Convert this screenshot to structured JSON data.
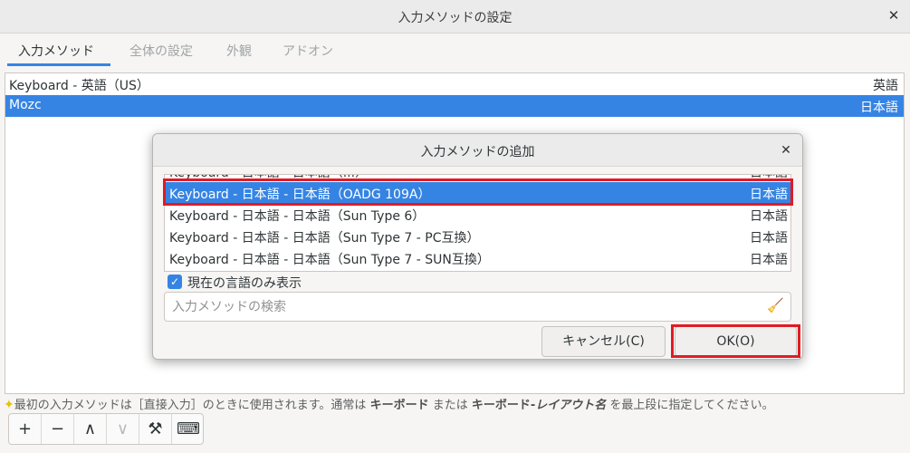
{
  "window": {
    "title": "入力メソッドの設定",
    "close_glyph": "✕"
  },
  "tabs": [
    {
      "label": "入力メソッド",
      "active": true
    },
    {
      "label": "全体の設定",
      "active": false
    },
    {
      "label": "外観",
      "active": false
    },
    {
      "label": "アドオン",
      "active": false
    }
  ],
  "input_methods": [
    {
      "name": "Keyboard - 英語（US）",
      "lang": "英語",
      "selected": false
    },
    {
      "name": "Mozc",
      "lang": "日本語",
      "selected": true
    }
  ],
  "hint": {
    "before": "最初の入力メソッドは［直接入力］のときに使用されます。通常は ",
    "kw1": "キーボード",
    "middle": " または ",
    "kw2": "キーボード-",
    "kw3": "レイアウト名",
    "after": " を最上段に指定してください。"
  },
  "toolbar": {
    "add": "+",
    "remove": "−",
    "up": "∧",
    "down": "∨",
    "configure": "⚒",
    "keyboard": "⌨"
  },
  "dialog": {
    "title": "入力メソッドの追加",
    "close_glyph": "✕",
    "rows": [
      {
        "name": "Keyboard - 日本語 - 日本語（...）",
        "lang": "日本語"
      },
      {
        "name": "Keyboard - 日本語 - 日本語（OADG 109A）",
        "lang": "日本語"
      },
      {
        "name": "Keyboard - 日本語 - 日本語（Sun Type 6）",
        "lang": "日本語"
      },
      {
        "name": "Keyboard - 日本語 - 日本語（Sun Type 7 - PC互換）",
        "lang": "日本語"
      },
      {
        "name": "Keyboard - 日本語 - 日本語（Sun Type 7 - SUN互換）",
        "lang": "日本語"
      }
    ],
    "checkbox_label": "現在の言語のみ表示",
    "checkbox_checked": true,
    "search_placeholder": "入力メソッドの検索",
    "cancel_label": "キャンセル(C)",
    "ok_label": "OK(O)"
  },
  "colors": {
    "accent": "#3584e4",
    "highlight": "#e01b24"
  }
}
